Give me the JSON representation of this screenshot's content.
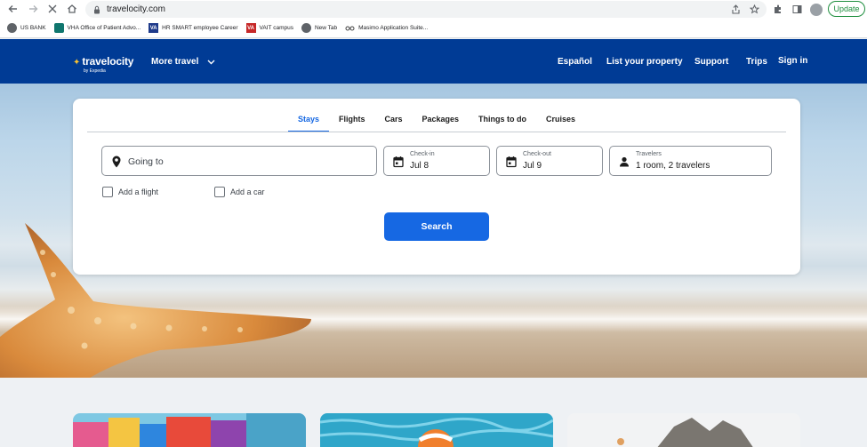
{
  "browser": {
    "url": "travelocity.com",
    "update_label": "Update",
    "bookmarks": [
      {
        "label": "US BANK",
        "icon": "globe-icon"
      },
      {
        "label": "VHA Office of Patient Advo...",
        "icon": "shield-icon"
      },
      {
        "label": "HR SMART employee Career",
        "icon": "va-logo-icon",
        "badge": "VA"
      },
      {
        "label": "VAIT campus",
        "icon": "va-red-logo-icon",
        "badge": "VA"
      },
      {
        "label": "New Tab",
        "icon": "globe-icon"
      },
      {
        "label": "Masimo Application Suite...",
        "icon": "masimo-icon"
      }
    ]
  },
  "header": {
    "brand": "travelocity",
    "brand_sub": "by Expedia",
    "more_travel": "More travel",
    "nav": [
      "Español",
      "List your property",
      "Support",
      "Trips",
      "Sign in"
    ]
  },
  "search": {
    "tabs": [
      {
        "label": "Stays",
        "active": true
      },
      {
        "label": "Flights",
        "active": false
      },
      {
        "label": "Cars",
        "active": false
      },
      {
        "label": "Packages",
        "active": false
      },
      {
        "label": "Things to do",
        "active": false
      },
      {
        "label": "Cruises",
        "active": false
      }
    ],
    "going_to_placeholder": "Going to",
    "checkin_label": "Check-in",
    "checkin_value": "Jul 8",
    "checkout_label": "Check-out",
    "checkout_value": "Jul 9",
    "travelers_label": "Travelers",
    "travelers_value": "1 room, 2 travelers",
    "add_flight": "Add a flight",
    "add_car": "Add a car",
    "search_button": "Search"
  },
  "colors": {
    "header_bg": "#003b95",
    "accent": "#1668e3"
  }
}
